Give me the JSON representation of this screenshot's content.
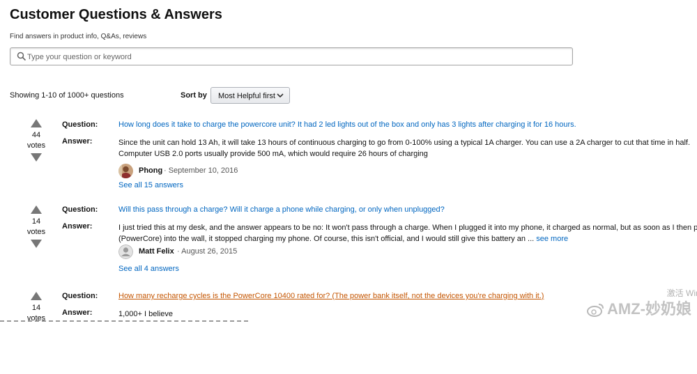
{
  "header": {
    "title": "Customer Questions & Answers",
    "subtitle": "Find answers in product info, Q&As, reviews"
  },
  "search": {
    "placeholder": "Type your question or keyword",
    "icon": "search-icon"
  },
  "listing": {
    "showing": "Showing 1-10 of 1000+ questions",
    "sort_label": "Sort by",
    "sort_value": "Most Helpful first"
  },
  "labels": {
    "question": "Question:",
    "answer": "Answer:",
    "votes": "votes"
  },
  "questions": [
    {
      "votes": "44",
      "question": "How long does it take to charge the powercore unit? It had 2 led lights out of the box and only has 3 lights after charging it for 16 hours.",
      "answer": "Since the unit can hold 13 Ah, it will take 13 hours of continuous charging to go from 0-100% using a typical 1A charger. You can use a 2A charger to cut that time in half.\nComputer USB 2.0 ports usually provide 500 mA, which would require 26 hours of charging",
      "author": "Phong",
      "date": "· September 10, 2016",
      "see_all": "See all 15 answers"
    },
    {
      "votes": "14",
      "question": "Will this pass through a charge? Will it charge a phone while charging, or only when unplugged?",
      "answer": "I just tried this at my desk, and the answer appears to be no: It won't pass through a charge. When I plugged it into my phone, it charged as normal, but as soon as I then plugg\n(PowerCore) into the wall, it stopped charging my phone. Of course, this isn't official, and I would still give this battery an ...",
      "see_more": "see more",
      "author": "Matt Felix",
      "date": "· August 26, 2015",
      "see_all": "See all 4 answers"
    },
    {
      "votes": "14",
      "question": "How many recharge cycles is the PowerCore 10400 rated for? (The power bank itself, not the devices you're charging with it.)",
      "answer": "1,000+ I believe"
    }
  ],
  "overlay": {
    "watermark": "AMZ-妙奶娘",
    "activate": "激活 Wir"
  },
  "colors": {
    "link": "#0066c0",
    "link_hover": "#c45500"
  }
}
